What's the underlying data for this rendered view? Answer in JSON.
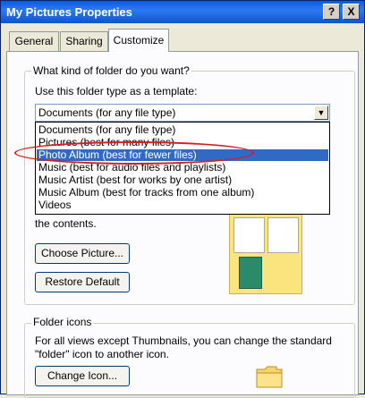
{
  "window": {
    "title": "My Pictures Properties"
  },
  "title_buttons": {
    "help": "?",
    "close": "X"
  },
  "tabs": [
    {
      "label": "General",
      "active": false
    },
    {
      "label": "Sharing",
      "active": false
    },
    {
      "label": "Customize",
      "active": true
    }
  ],
  "folder_type": {
    "legend": "What kind of folder do you want?",
    "template_label": "Use this folder type as a template:",
    "selected_value": "Documents (for any file type)",
    "options": [
      "Documents (for any file type)",
      "Pictures (best for many files)",
      "Photo Album (best for fewer files)",
      "Music (best for audio files and playlists)",
      "Music Artist (best for works by one artist)",
      "Music Album (best for tracks from one album)",
      "Videos"
    ],
    "highlighted_index": 2
  },
  "folder_pictures": {
    "partial_text": "the contents.",
    "choose_picture_label": "Choose Picture...",
    "restore_default_label": "Restore Default"
  },
  "folder_icons": {
    "legend": "Folder icons",
    "description_line1": "For all views except Thumbnails, you can change the standard",
    "description_line2": "\"folder\" icon to another icon.",
    "change_icon_label": "Change Icon..."
  },
  "colors": {
    "title_bar": "#0a5adf",
    "selection": "#316ac5",
    "annotation_ring": "#d02020",
    "preview_background": "#fae47e"
  }
}
